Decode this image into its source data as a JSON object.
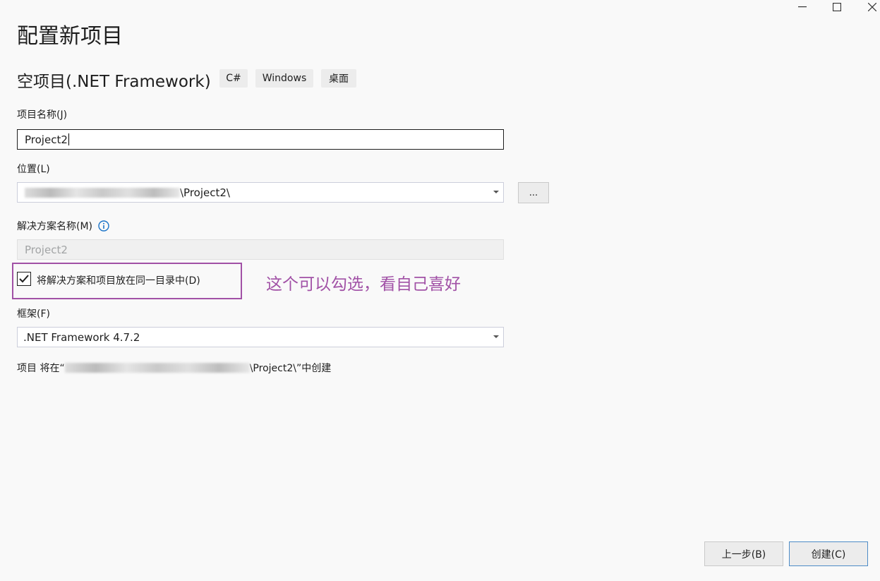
{
  "window": {
    "minimize_label": "—",
    "maximize_label": "☐",
    "close_label": "✕"
  },
  "page_title": "配置新项目",
  "template": {
    "name": "空项目(.NET Framework)",
    "tags": [
      "C#",
      "Windows",
      "桌面"
    ]
  },
  "project_name": {
    "label": "项目名称(J)",
    "value": "Project2"
  },
  "location": {
    "label": "位置(L)",
    "value_suffix": "\\Project2\\",
    "browse_label": "..."
  },
  "solution_name": {
    "label": "解决方案名称(M)",
    "value": "Project2"
  },
  "same_dir_checkbox": {
    "label": "将解决方案和项目放在同一目录中(D)",
    "checked": true
  },
  "annotation": "这个可以勾选，看自己喜好",
  "framework": {
    "label": "框架(F)",
    "value": ".NET Framework 4.7.2"
  },
  "summary": {
    "prefix": "项目 将在“",
    "suffix": "\\Project2\\”中创建"
  },
  "buttons": {
    "back": "上一步(B)",
    "create": "创建(C)"
  },
  "colors": {
    "annotation": "#a151a6",
    "info_icon": "#1a73c8",
    "primary_border": "#4d8cc7"
  }
}
